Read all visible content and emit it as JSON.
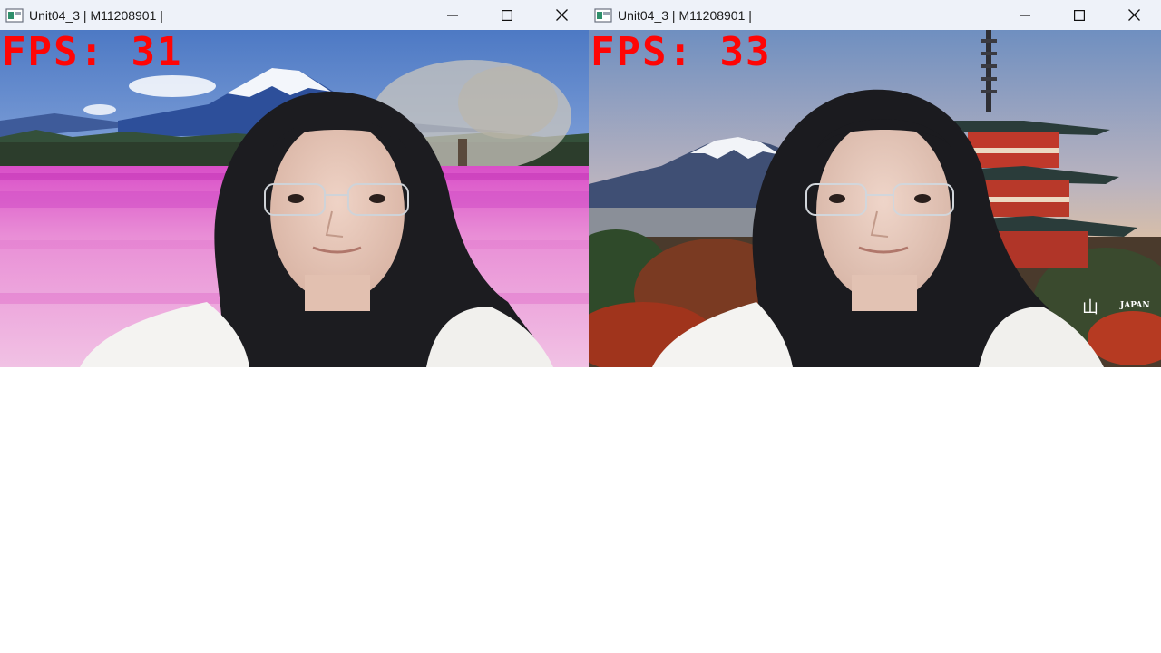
{
  "windows": [
    {
      "title": "Unit04_3 | M11208901 |",
      "fps_label": "FPS: 31",
      "background_scene": "mount-fuji-pink-moss-phlox-field",
      "icons": [
        "app-icon",
        "minimize-icon",
        "maximize-icon",
        "close-icon"
      ]
    },
    {
      "title": "Unit04_3 | M11208901 |",
      "fps_label": "FPS: 33",
      "background_scene": "mount-fuji-chureito-pagoda-autumn",
      "overlay_text": {
        "kanji": "山",
        "caption": "JAPAN"
      },
      "icons": [
        "app-icon",
        "minimize-icon",
        "maximize-icon",
        "close-icon"
      ]
    }
  ],
  "colors": {
    "titlebar": "#eef2f9",
    "fps_text": "#ff0505",
    "desktop": "#ffffff"
  }
}
